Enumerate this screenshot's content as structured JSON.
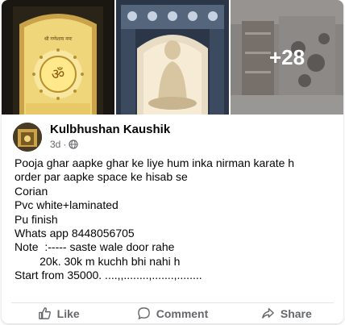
{
  "gallery": {
    "tile1_texts": [
      "श्री गणेशाय नमः",
      "ॐ"
    ],
    "more_count": "+28"
  },
  "post": {
    "author": "Kulbhushan Kaushik",
    "time": "3d",
    "lines": [
      "Pooja ghar aapke ghar ke liye hum inka nirman karate h",
      "order par aapke space ke hisab se",
      "Corian",
      "Pvc white+laminated",
      "Pu finish",
      "Whats app 8448056705",
      "Note  :----- saste wale door rahe",
      "        20k. 30k m kuchh bhi nahi h",
      "Start from 35000. ....,,........,.......,........"
    ]
  },
  "actions": {
    "like": "Like",
    "comment": "Comment",
    "share": "Share"
  },
  "colors": {
    "secondary_text": "#65676b",
    "divider": "#e4e6eb"
  }
}
